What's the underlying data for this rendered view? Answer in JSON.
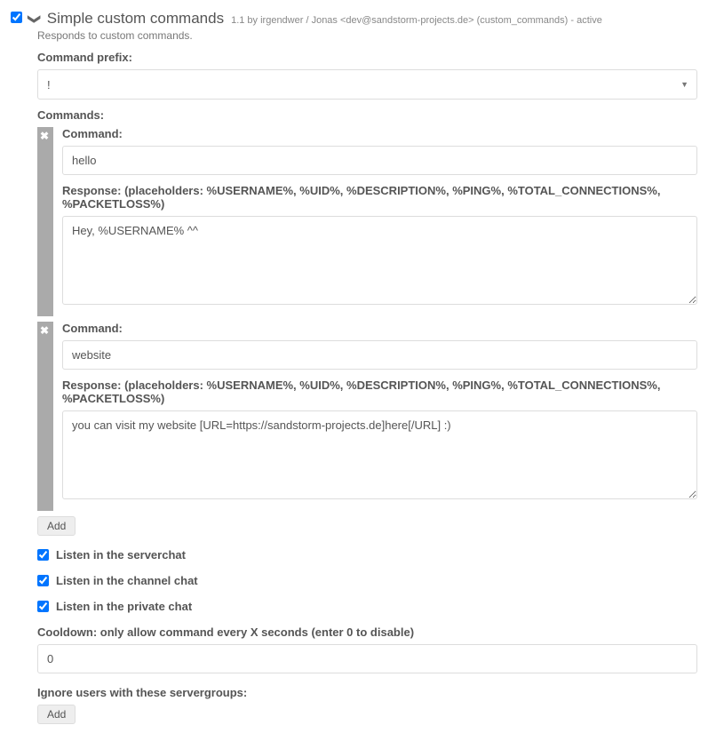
{
  "header": {
    "enabled": true,
    "title": "Simple custom commands",
    "meta": "1.1 by irgendwer / Jonas <dev@sandstorm-projects.de> (custom_commands) - active",
    "subtitle": "Responds to custom commands."
  },
  "prefix": {
    "label": "Command prefix:",
    "value": "!"
  },
  "commands_label": "Commands:",
  "command_field_label": "Command:",
  "response_field_label": "Response: (placeholders: %USERNAME%, %UID%, %DESCRIPTION%, %PING%, %TOTAL_CONNECTIONS%, %PACKETLOSS%)",
  "commands": [
    {
      "command": "hello",
      "response": "Hey, %USERNAME% ^^"
    },
    {
      "command": "website",
      "response": "you can visit my website [URL=https://sandstorm-projects.de]here[/URL] :)"
    }
  ],
  "add_button": "Add",
  "listen": {
    "server": {
      "label": "Listen in the serverchat",
      "checked": true
    },
    "channel": {
      "label": "Listen in the channel chat",
      "checked": true
    },
    "private": {
      "label": "Listen in the private chat",
      "checked": true
    }
  },
  "cooldown": {
    "label": "Cooldown: only allow command every X seconds (enter 0 to disable)",
    "value": "0"
  },
  "ignore": {
    "label": "Ignore users with these servergroups:",
    "add_button": "Add"
  }
}
